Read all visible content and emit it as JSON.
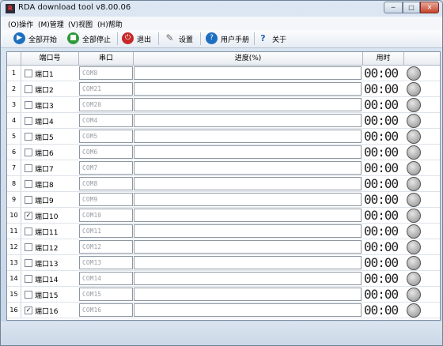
{
  "window": {
    "title": "RDA download tool v8.00.06",
    "logo_text": "R",
    "controls": {
      "minimize": "─",
      "maximize": "□",
      "close": "✕"
    }
  },
  "menu": [
    "(O)操作",
    "(M)管理",
    "(V)视图",
    "(H)帮助"
  ],
  "toolbar": {
    "start_all": {
      "label": "全部开始",
      "icon": "play-icon",
      "color": "#1f6fc1"
    },
    "stop_all": {
      "label": "全部停止",
      "icon": "stop-icon",
      "color": "#2f9a3b"
    },
    "exit": {
      "label": "退出",
      "icon": "power-icon",
      "color": "#c62828"
    },
    "settings": {
      "label": "设置",
      "icon": "settings-icon"
    },
    "manual": {
      "label": "用户手册",
      "icon": "help-icon",
      "color": "#1f6fc1"
    },
    "about": {
      "label": "关于",
      "icon": "about-icon"
    }
  },
  "columns": {
    "port": "端口号",
    "serial": "串口",
    "progress": "进度(%)",
    "time": "用时"
  },
  "rows": [
    {
      "num": "1",
      "checked": false,
      "port": "端口1",
      "com": "COM8",
      "time": "00:00"
    },
    {
      "num": "2",
      "checked": false,
      "port": "端口2",
      "com": "COM21",
      "time": "00:00"
    },
    {
      "num": "3",
      "checked": false,
      "port": "端口3",
      "com": "COM20",
      "time": "00:00"
    },
    {
      "num": "4",
      "checked": false,
      "port": "端口4",
      "com": "COM4",
      "time": "00:00"
    },
    {
      "num": "5",
      "checked": false,
      "port": "端口5",
      "com": "COM5",
      "time": "00:00"
    },
    {
      "num": "6",
      "checked": false,
      "port": "端口6",
      "com": "COM6",
      "time": "00:00"
    },
    {
      "num": "7",
      "checked": false,
      "port": "端口7",
      "com": "COM7",
      "time": "00:00"
    },
    {
      "num": "8",
      "checked": false,
      "port": "端口8",
      "com": "COM8",
      "time": "00:00"
    },
    {
      "num": "9",
      "checked": false,
      "port": "端口9",
      "com": "COM9",
      "time": "00:00"
    },
    {
      "num": "10",
      "checked": true,
      "port": "端口10",
      "com": "COM10",
      "time": "00:00"
    },
    {
      "num": "11",
      "checked": false,
      "port": "端口11",
      "com": "COM11",
      "time": "00:00"
    },
    {
      "num": "12",
      "checked": false,
      "port": "端口12",
      "com": "COM12",
      "time": "00:00"
    },
    {
      "num": "13",
      "checked": false,
      "port": "端口13",
      "com": "COM13",
      "time": "00:00"
    },
    {
      "num": "14",
      "checked": false,
      "port": "端口14",
      "com": "COM14",
      "time": "00:00"
    },
    {
      "num": "15",
      "checked": false,
      "port": "端口15",
      "com": "COM15",
      "time": "00:00"
    },
    {
      "num": "16",
      "checked": true,
      "port": "端口16",
      "com": "COM16",
      "time": "00:00"
    }
  ]
}
